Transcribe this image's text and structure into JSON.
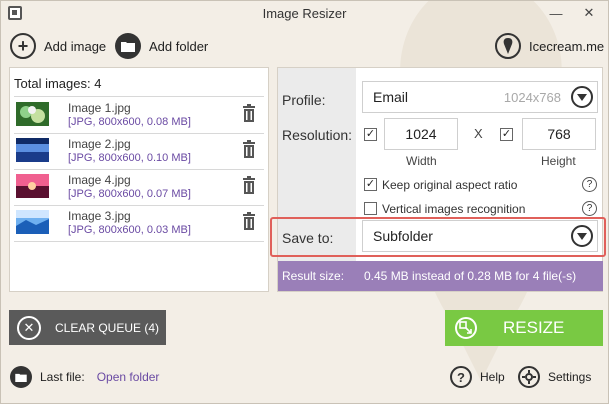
{
  "window": {
    "title": "Image Resizer",
    "icons": {
      "app": "app-icon",
      "minimize": "minimize-icon",
      "close": "close-icon"
    },
    "minimize_glyph": "—",
    "close_glyph": "✕"
  },
  "toolbar": {
    "add_image_label": "Add image",
    "add_folder_label": "Add folder",
    "icecream_label": "Icecream.me",
    "icons": {
      "add_image": "plus-icon",
      "add_folder": "folder-icon",
      "icecream": "icecream-icon"
    }
  },
  "list": {
    "header": "Total images: 4",
    "items": [
      {
        "name": "Image 1.jpg",
        "info": "[JPG, 800x600, 0.08 MB]",
        "thumb_colors": [
          "#2f6b2a",
          "#8fd18a",
          "#5a9e3b"
        ]
      },
      {
        "name": "Image 2.jpg",
        "info": "[JPG, 800x600, 0.10 MB]",
        "thumb_colors": [
          "#1a3c8a",
          "#5b8fe0",
          "#0f2a66"
        ]
      },
      {
        "name": "Image 4.jpg",
        "info": "[JPG, 800x600, 0.07 MB]",
        "thumb_colors": [
          "#b0205a",
          "#f06090",
          "#5a1030"
        ]
      },
      {
        "name": "Image 3.jpg",
        "info": "[JPG, 800x600, 0.03 MB]",
        "thumb_colors": [
          "#1b5fb8",
          "#6fb0f0",
          "#cfe6ff"
        ]
      }
    ],
    "delete_icon": "trash-icon"
  },
  "settings": {
    "profile_label": "Profile:",
    "profile_value": "Email",
    "profile_size": "1024x768",
    "resolution_label": "Resolution:",
    "width_value": "1024",
    "height_value": "768",
    "x_separator": "X",
    "width_label": "Width",
    "height_label": "Height",
    "keep_ratio_label": "Keep original aspect ratio",
    "vertical_label": "Vertical images recognition",
    "keep_ratio_checked": true,
    "vertical_checked": false,
    "save_to_label": "Save to:",
    "save_to_value": "Subfolder",
    "help_glyph": "?",
    "result_label": "Result size:",
    "result_value": "0.45 MB instead of 0.28 MB for 4 file(-s)"
  },
  "actions": {
    "clear_queue_label": "CLEAR QUEUE (4)",
    "resize_label": "RESIZE",
    "clear_glyph": "✕"
  },
  "footer": {
    "last_file_label": "Last file:",
    "open_folder_label": "Open folder",
    "help_label": "Help",
    "settings_label": "Settings",
    "question_glyph": "?"
  },
  "colors": {
    "accent_purple": "#9a7fb8",
    "resize_green": "#79c943",
    "highlight_red": "#e0605a",
    "clear_gray": "#5a5a5a"
  }
}
